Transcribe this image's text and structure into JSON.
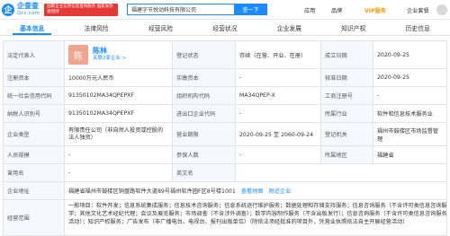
{
  "header": {
    "logo_char": "企",
    "logo_cn": "企查查",
    "logo_en": "Qcc.com",
    "badge_text": "国家企业信用信息查询服务 国家发改委授牌",
    "search_value": "福建字节悦动科技有限公司",
    "search_button": "查一下",
    "nav": [
      "应用",
      "品牌",
      "VIP服务",
      "企业套餐"
    ]
  },
  "tabs": [
    {
      "label": "基本信息",
      "count": "",
      "active": true
    },
    {
      "label": "法律风险",
      "count": "",
      "active": false
    },
    {
      "label": "经营风险",
      "count": "",
      "active": false
    },
    {
      "label": "经营状况",
      "count": "",
      "active": false
    },
    {
      "label": "企业发展",
      "count": "",
      "active": false
    },
    {
      "label": "知识产权",
      "count": "",
      "active": false
    },
    {
      "label": "历史信息",
      "count": "",
      "active": false
    }
  ],
  "info": {
    "legal_rep_label": "法定代表人",
    "legal_rep_avatar": "陈",
    "legal_rep_name": "陈林",
    "legal_rep_related": "关联2家企业 >",
    "status_label": "登记状态",
    "status_value": "存续（在营、开业、在册）",
    "est_date_label": "成立日期",
    "est_date_value": "2020-09-25",
    "reg_cap_label": "注册资本",
    "reg_cap_value": "10000万元人民币",
    "paid_cap_label": "实缴资本",
    "paid_cap_value": "-",
    "approve_label": "核准日期",
    "approve_value": "2020-09-25",
    "credit_code_label": "统一社会信用代码",
    "credit_code_value": "91350102MA34QPEPXF",
    "org_code_label": "组织机构代码",
    "org_code_value": "MA34QPEP-X",
    "biz_reg_label": "工商注册号",
    "biz_reg_value": "-",
    "tax_id_label": "纳税人识别号",
    "tax_id_value": "91350102MA34QPEPXF",
    "import_label": "进出口企业代码",
    "import_value": "-",
    "industry_label": "所属行业",
    "industry_value": "软件和信息技术服务业",
    "type_label": "企业类型",
    "type_value": "有限责任公司（非自然人投资或控股的法人独资）",
    "term_label": "营业期限",
    "term_value": "2020-09-25 至 2060-09-24",
    "authority_label": "登记机关",
    "authority_value": "福州市鼓楼区市场监督管理",
    "staff_label": "人员规模",
    "staff_value": "-",
    "insured_label": "参保人数",
    "insured_value": "-",
    "region_label": "所属地区",
    "region_value": "福建省",
    "former_label": "曾用名",
    "former_value": "-",
    "eng_label": "英文名",
    "eng_value": "",
    "address_label": "企业地址",
    "address_value": "福建省福州市鼓楼区铜盘路软件大道89号福州软件园F区8号楼1001",
    "address_link1": "查看地图",
    "address_link2": "附近企业",
    "scope_label": "经营范围",
    "scope_line1": "一般项目：软件开发；信息系统集成服务；信息技术咨询服务；信息系统运行维护服务；数据处理和存储支持服务；信息咨询服务（不含许可类信息咨询服务）；广告设计、代理；文",
    "scope_line2": "字；其他文化艺术经纪代理；会议及展览服务；市场调查（不含涉外调查）；数字内容制作服务（不含出版发行）；信息咨询服务（不含许可类信息咨询服务）；教育咨询服务（不含涉许可审批的教育培训",
    "scope_line3": "活动）；知识产权服务；广告发布（非广播电台、电视台、报刊出版单位）（除依法须经批准的项目外，凭营业执照依法自主开展经营活动）"
  }
}
